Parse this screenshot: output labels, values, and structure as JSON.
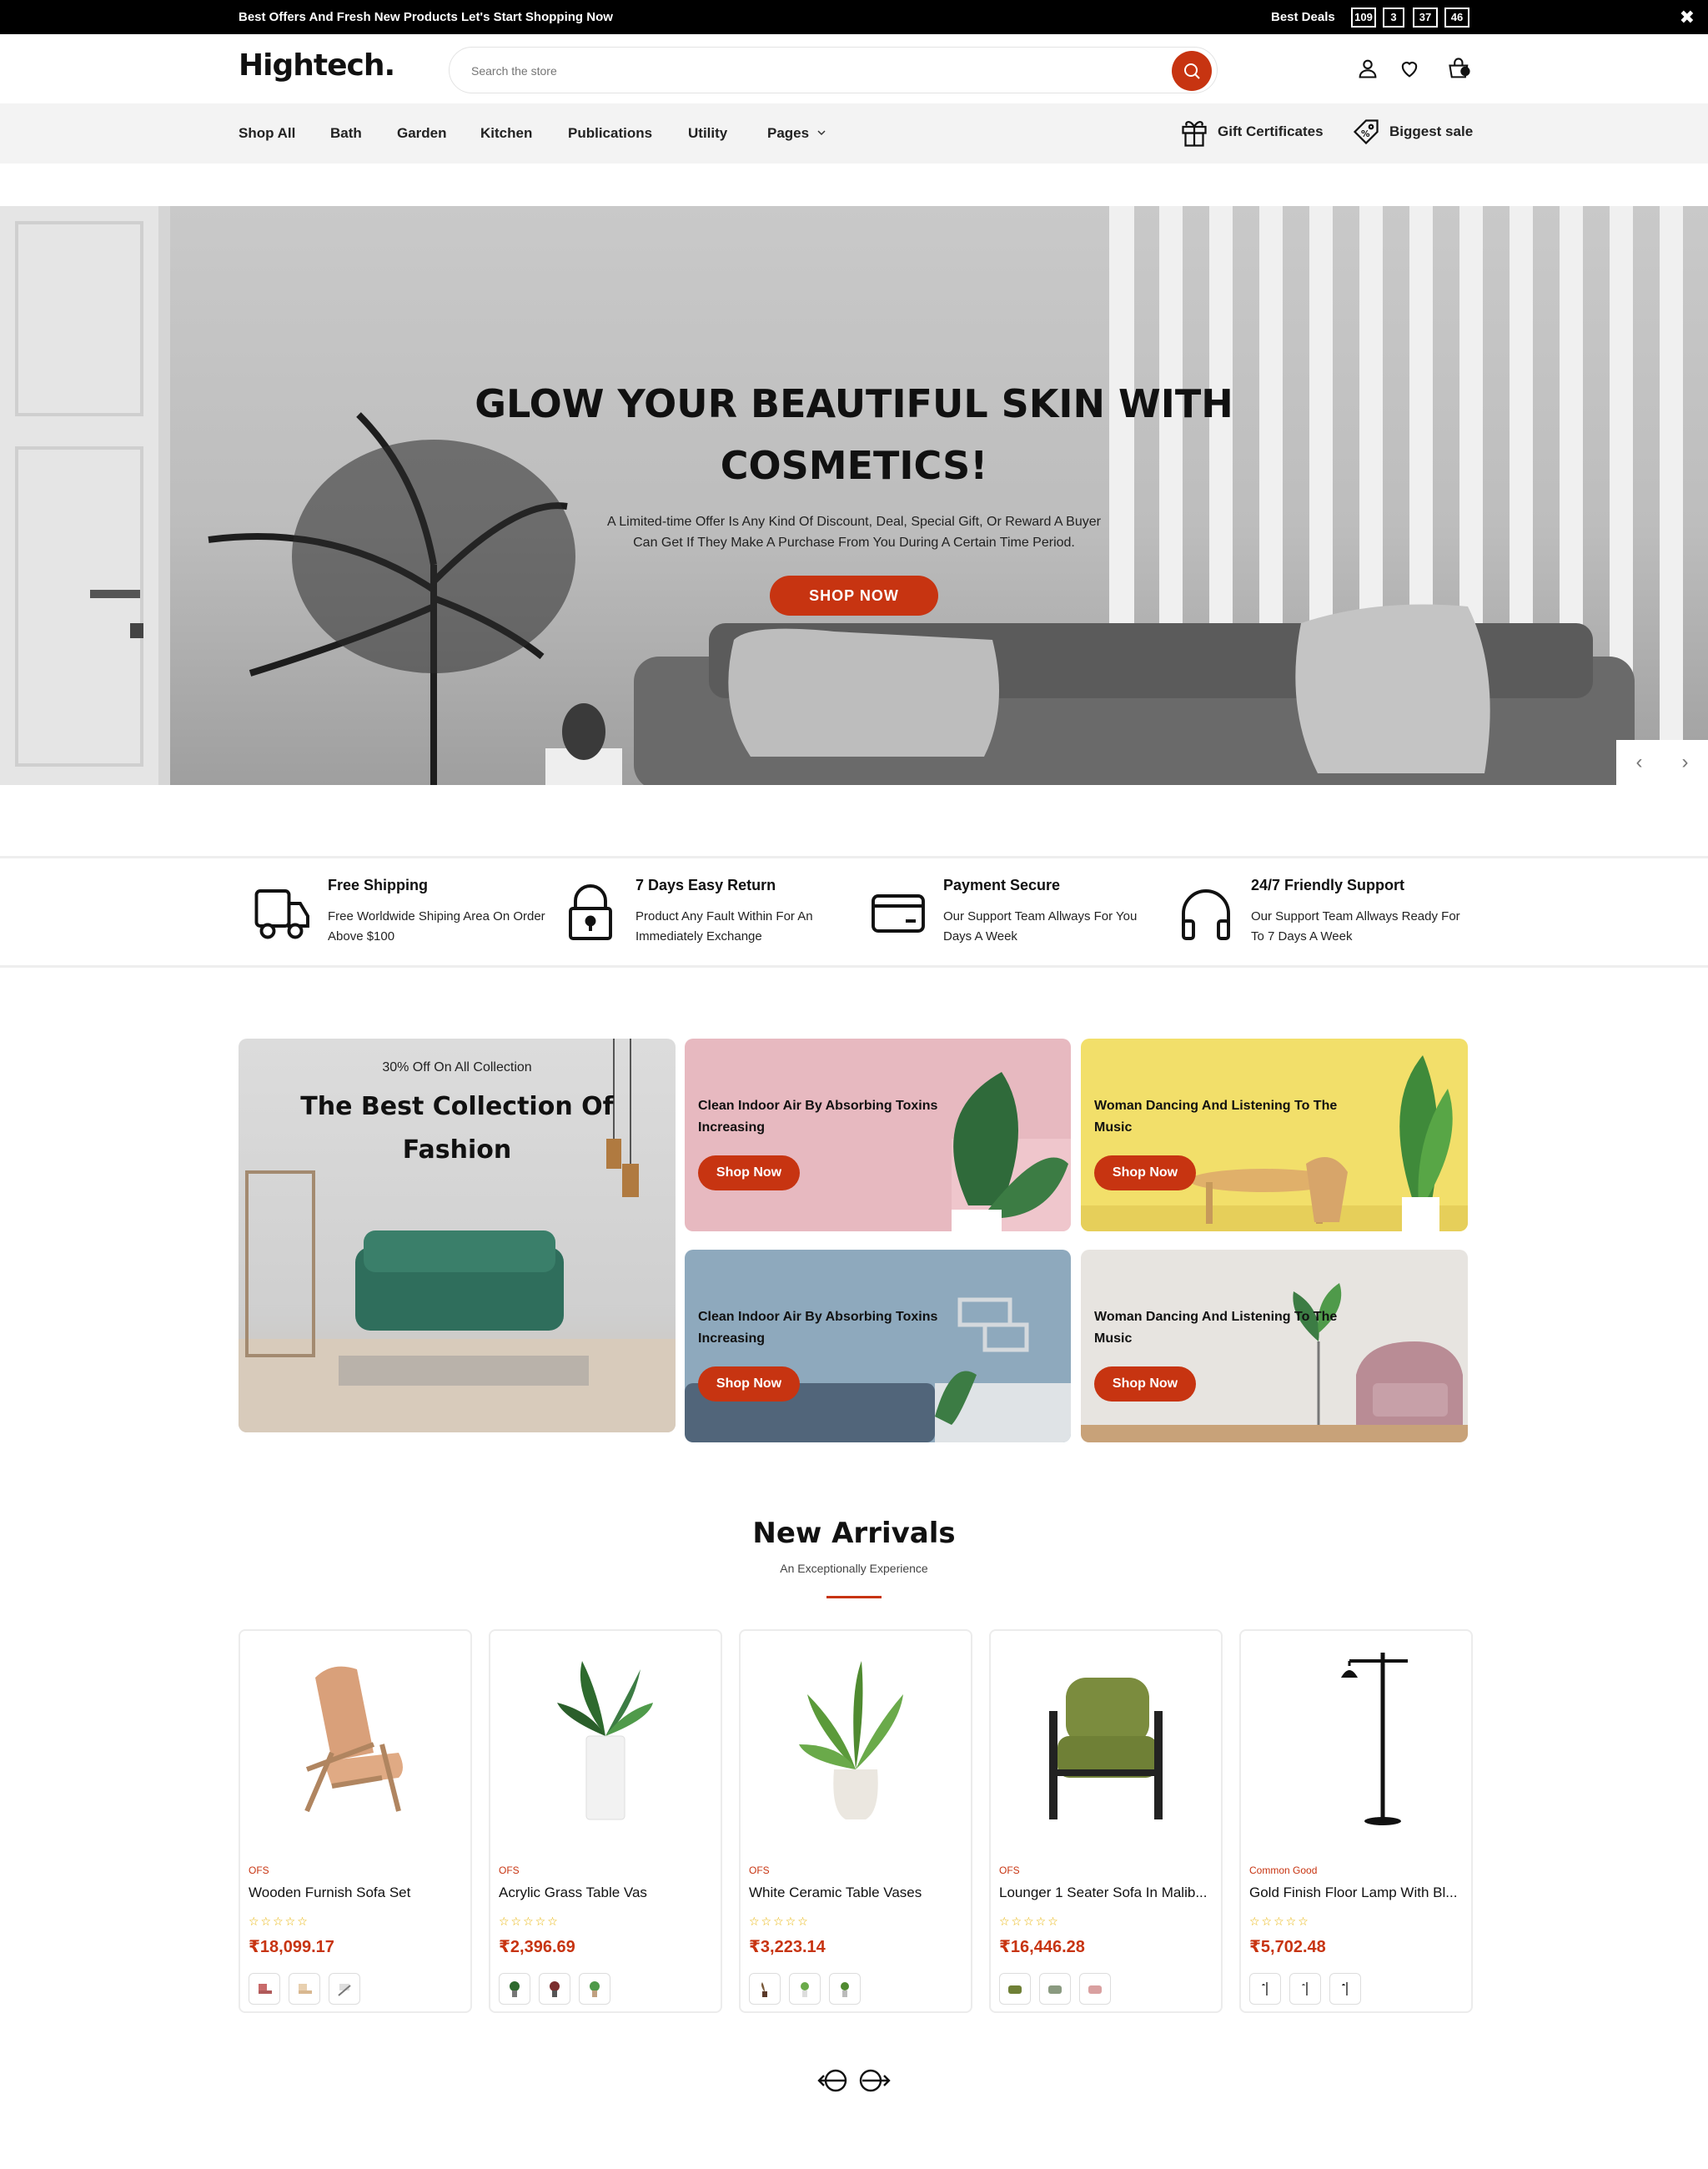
{
  "topbar": {
    "promo": "Best Offers And Fresh New Products Let's Start Shopping Now",
    "deals_label": "Best Deals",
    "timer": [
      "109",
      "3",
      "37",
      "46"
    ],
    "close": "✖"
  },
  "header": {
    "logo": "Hightech.",
    "search_placeholder": "Search the store"
  },
  "nav": {
    "items": [
      "Shop All",
      "Bath",
      "Garden",
      "Kitchen",
      "Publications",
      "Utility",
      "Pages"
    ],
    "gift": "Gift Certificates",
    "sale": "Biggest sale"
  },
  "hero": {
    "title_line1": "GLOW YOUR BEAUTIFUL SKIN WITH",
    "title_line2": "COSMETICS!",
    "desc_line1": "A Limited-time Offer Is Any Kind Of Discount, Deal, Special Gift, Or Reward A Buyer",
    "desc_line2": "Can Get If They Make A Purchase From You During A Certain Time Period.",
    "cta": "SHOP NOW"
  },
  "features": [
    {
      "title": "Free Shipping",
      "desc": "Free Worldwide Shiping Area On Order Above $100",
      "icon": "truck-icon"
    },
    {
      "title": "7 Days Easy Return",
      "desc": "Product Any Fault Within For An Immediately Exchange",
      "icon": "lock-icon"
    },
    {
      "title": "Payment Secure",
      "desc": "Our Support Team Allways For You Days A Week",
      "icon": "card-icon"
    },
    {
      "title": "24/7 Friendly Support",
      "desc": "Our Support Team Allways Ready For To 7 Days A Week",
      "icon": "headphones-icon"
    }
  ],
  "banners": {
    "main_kicker": "30% Off On All Collection",
    "main_title_line1": "The Best Collection Of",
    "main_title_line2": "Fashion",
    "tiles": [
      {
        "title": "Clean Indoor Air By Absorbing Toxins Increasing",
        "button": "Shop Now"
      },
      {
        "title": "Woman Dancing And Listening To The Music",
        "button": "Shop Now"
      },
      {
        "title": "Clean Indoor Air By Absorbing Toxins Increasing",
        "button": "Shop Now"
      },
      {
        "title": "Woman Dancing And Listening To The Music",
        "button": "Shop Now"
      }
    ]
  },
  "arrivals": {
    "title": "New Arrivals",
    "subtitle": "An Exceptionally Experience",
    "products": [
      {
        "brand": "OFS",
        "name": "Wooden Furnish Sofa Set",
        "rating": "☆☆☆☆☆",
        "price": "₹18,099.17"
      },
      {
        "brand": "OFS",
        "name": "Acrylic Grass Table Vas",
        "rating": "☆☆☆☆☆",
        "price": "₹2,396.69"
      },
      {
        "brand": "OFS",
        "name": "White Ceramic Table Vases",
        "rating": "☆☆☆☆☆",
        "price": "₹3,223.14"
      },
      {
        "brand": "OFS",
        "name": "Lounger 1 Seater Sofa In Malib...",
        "rating": "☆☆☆☆☆",
        "price": "₹16,446.28"
      },
      {
        "brand": "Common Good",
        "name": "Gold Finish Floor Lamp With Bl...",
        "rating": "☆☆☆☆☆",
        "price": "₹5,702.48"
      }
    ]
  },
  "colors": {
    "accent": "#c73411",
    "topbar": "#000000",
    "nav_bg": "#f3f3f3"
  }
}
